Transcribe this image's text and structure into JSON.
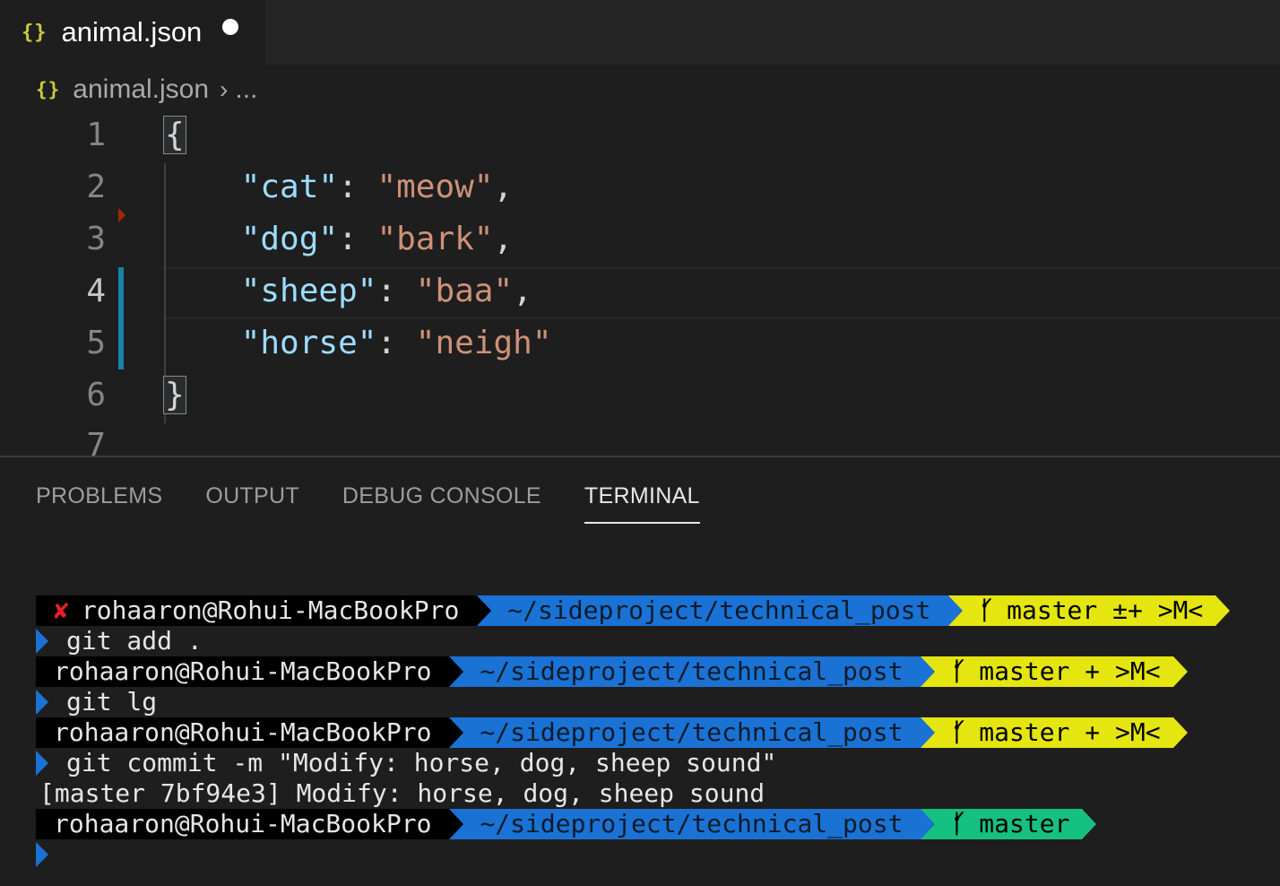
{
  "tab": {
    "icon": "json-braces-icon",
    "icon_text": "{}",
    "label": "animal.json",
    "dirty": true
  },
  "breadcrumb": {
    "icon_text": "{}",
    "file": "animal.json",
    "more": "..."
  },
  "editor": {
    "line_numbers": [
      "1",
      "2",
      "3",
      "4",
      "5",
      "6",
      "7"
    ],
    "lines": [
      {
        "open": "{"
      },
      {
        "key": "\"cat\"",
        "value": "\"meow\"",
        "trail": ","
      },
      {
        "key": "\"dog\"",
        "value": "\"bark\"",
        "trail": ","
      },
      {
        "key": "\"sheep\"",
        "value": "\"baa\"",
        "trail": ","
      },
      {
        "key": "\"horse\"",
        "value": "\"neigh\"",
        "trail": ""
      },
      {
        "close": "}"
      }
    ],
    "colors": {
      "key": "#9cdcfe",
      "string": "#ce9178",
      "git_modified": "#1b81a8",
      "git_deleted": "#a1260d"
    }
  },
  "panel": {
    "tabs": [
      "PROBLEMS",
      "OUTPUT",
      "DEBUG CONSOLE",
      "TERMINAL"
    ],
    "active_tab": "TERMINAL"
  },
  "terminal": {
    "prompts": [
      {
        "error_mark": "✘",
        "user": "rohaaron@Rohui-MacBookPro",
        "path": "~/sideproject/technical_post",
        "branch": "master ±+ >M<",
        "git_color": "#e5e510"
      },
      {
        "user": "rohaaron@Rohui-MacBookPro",
        "path": "~/sideproject/technical_post",
        "branch": "master + >M<",
        "git_color": "#e5e510"
      },
      {
        "user": "rohaaron@Rohui-MacBookPro",
        "path": "~/sideproject/technical_post",
        "branch": "master + >M<",
        "git_color": "#e5e510"
      },
      {
        "user": "rohaaron@Rohui-MacBookPro",
        "path": "~/sideproject/technical_post",
        "branch": "master",
        "git_color": "#16c080"
      }
    ],
    "commands": [
      "git add .",
      "git lg",
      "git commit -m \"Modify: horse, dog, sheep sound\""
    ],
    "output": [
      "[master 7bf94e3] Modify: horse, dog, sheep sound"
    ],
    "branch_icon": "git-branch-icon",
    "path_color": "#1a72d4"
  }
}
